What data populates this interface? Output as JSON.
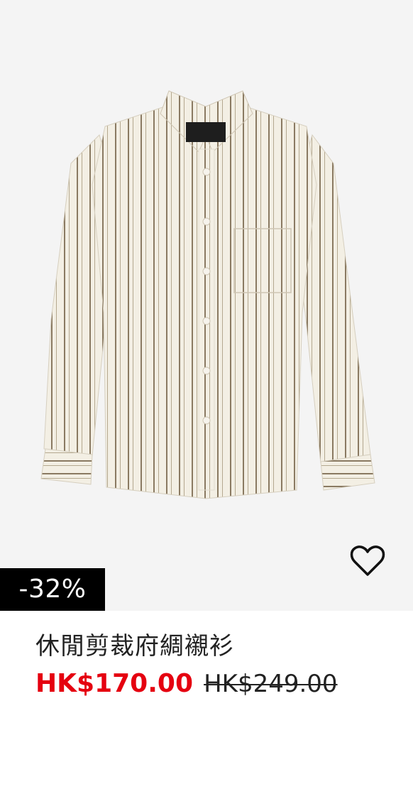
{
  "product": {
    "name": "休閒剪裁府綢襯衫",
    "sale_price": "HK$170.00",
    "original_price": "HK$249.00",
    "discount_badge": "-32%",
    "sale_color": "#e50010"
  },
  "icons": {
    "favorite": "heart-outline-icon"
  }
}
